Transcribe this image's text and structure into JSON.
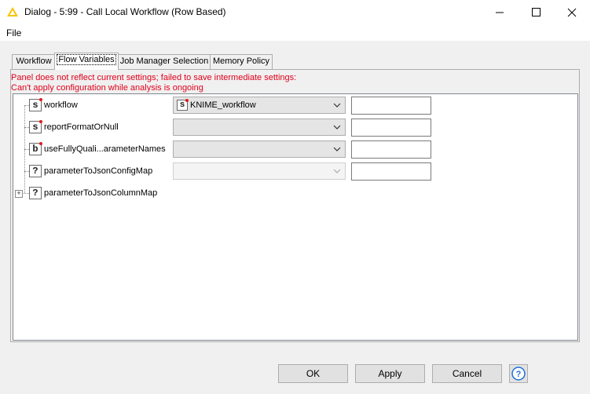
{
  "window": {
    "title": "Dialog - 5:99 - Call Local Workflow (Row Based)",
    "controls": [
      "minimize-icon",
      "maximize-icon",
      "close-icon"
    ]
  },
  "menu": {
    "file": "File"
  },
  "tabs": [
    {
      "label": "Workflow",
      "active": false
    },
    {
      "label": "Flow Variables",
      "active": true
    },
    {
      "label": "Job Manager Selection",
      "active": false
    },
    {
      "label": "Memory Policy",
      "active": false
    }
  ],
  "warnings": {
    "line1": "Panel does not reflect current settings; failed to save intermediate settings:",
    "line2": "Can't apply configuration while analysis is ongoing"
  },
  "rows": [
    {
      "type_icon": "s",
      "label": "workflow",
      "combo_type_icon": "s",
      "combo_value": "KNIME_workflow",
      "text": ""
    },
    {
      "type_icon": "s",
      "label": "reportFormatOrNull",
      "combo_value": "",
      "text": ""
    },
    {
      "type_icon": "b",
      "label": "useFullyQuali...arameterNames",
      "combo_value": "",
      "text": ""
    },
    {
      "type_icon": "?",
      "label": "parameterToJsonConfigMap",
      "combo_value": "",
      "text": ""
    },
    {
      "type_icon": "?",
      "label": "parameterToJsonColumnMap"
    }
  ],
  "buttons": {
    "ok": "OK",
    "apply": "Apply",
    "cancel": "Cancel",
    "help": "help-icon"
  },
  "colors": {
    "warning": "#e0001b",
    "variable_dot": "#e21a1a",
    "knime_yellow": "#f7c400",
    "help_blue": "#1e6fd9"
  }
}
